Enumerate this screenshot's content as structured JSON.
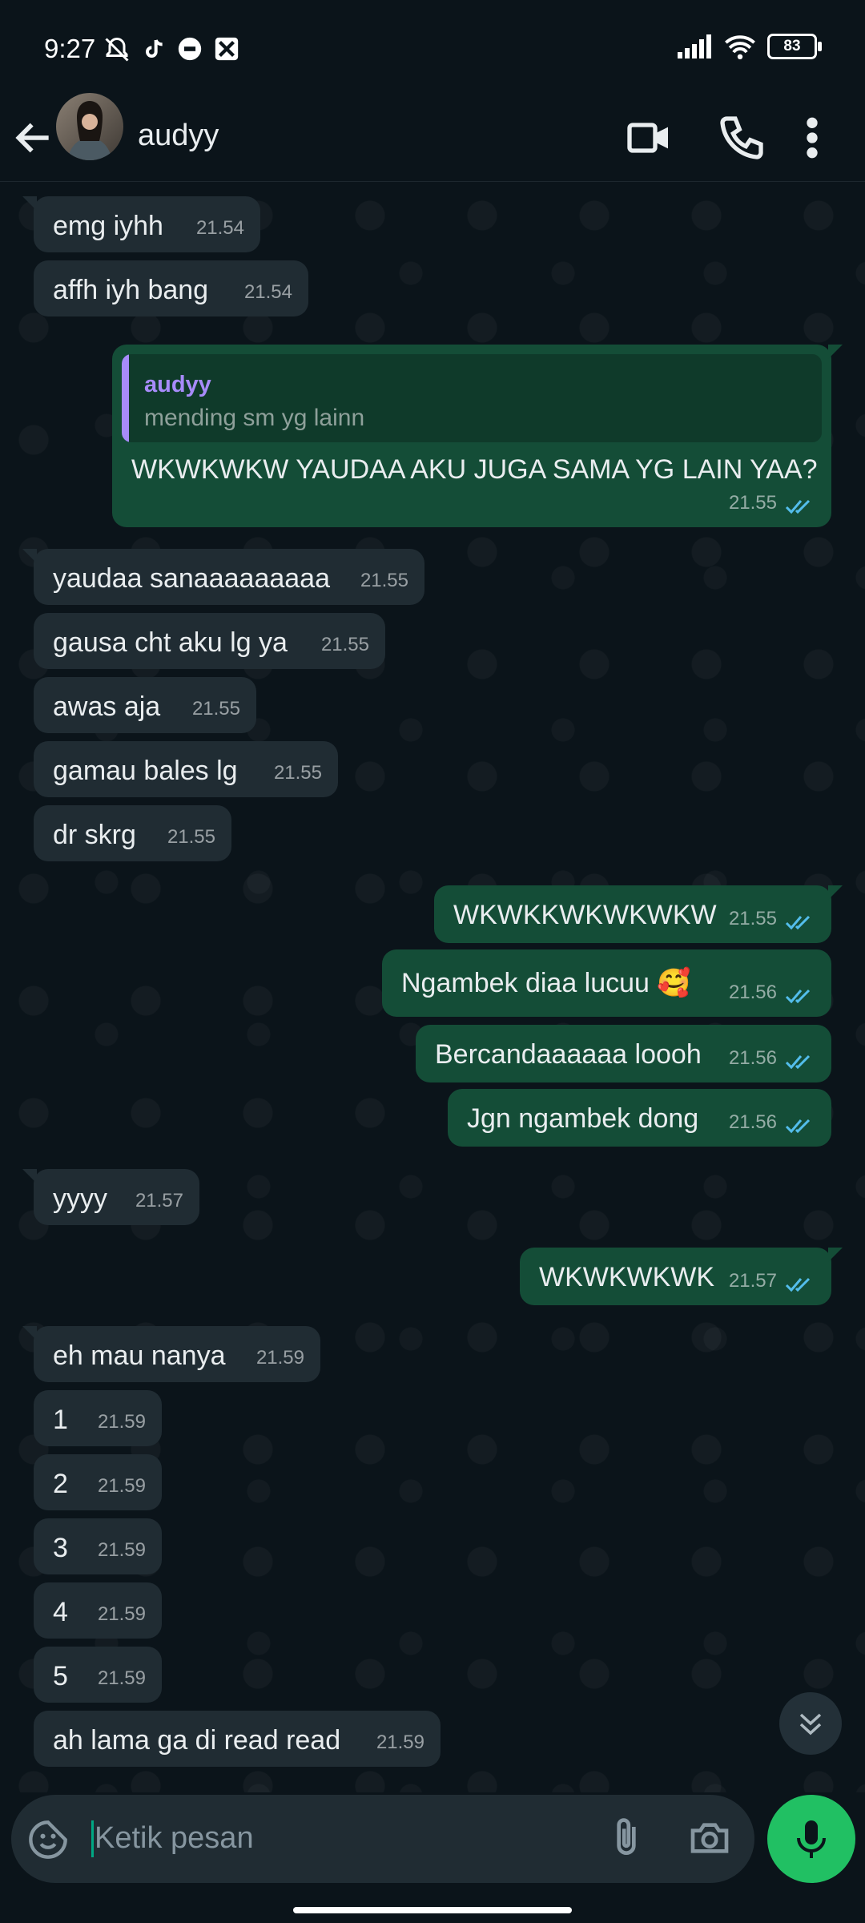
{
  "status_bar": {
    "time": "9:27",
    "battery": "83"
  },
  "header": {
    "contact_name": "audyy"
  },
  "messages": [
    {
      "text": "emg iyhh",
      "time": "21.54",
      "dir": "in"
    },
    {
      "text": "affh iyh bang",
      "time": "21.54",
      "dir": "in"
    },
    {
      "quote_name": "audyy",
      "quote_text": "mending sm yg lainn",
      "text": "WKWKWKW YAUDAA AKU JUGA SAMA YG LAIN YAA?",
      "time": "21.55",
      "dir": "out"
    },
    {
      "text": "yaudaa sanaaaaaaaaa",
      "time": "21.55",
      "dir": "in"
    },
    {
      "text": "gausa cht aku lg ya",
      "time": "21.55",
      "dir": "in"
    },
    {
      "text": "awas aja",
      "time": "21.55",
      "dir": "in"
    },
    {
      "text": "gamau bales lg",
      "time": "21.55",
      "dir": "in"
    },
    {
      "text": "dr skrg",
      "time": "21.55",
      "dir": "in"
    },
    {
      "text": "WKWKKWKWKWKW",
      "time": "21.55",
      "dir": "out"
    },
    {
      "text": "Ngambek diaa lucuu 🥰",
      "time": "21.56",
      "dir": "out"
    },
    {
      "text": "Bercandaaaaaa loooh",
      "time": "21.56",
      "dir": "out"
    },
    {
      "text": "Jgn ngambek dong",
      "time": "21.56",
      "dir": "out"
    },
    {
      "text": "yyyy",
      "time": "21.57",
      "dir": "in"
    },
    {
      "text": "WKWKWKWK",
      "time": "21.57",
      "dir": "out"
    },
    {
      "text": "eh mau nanya",
      "time": "21.59",
      "dir": "in"
    },
    {
      "text": "1",
      "time": "21.59",
      "dir": "in"
    },
    {
      "text": "2",
      "time": "21.59",
      "dir": "in"
    },
    {
      "text": "3",
      "time": "21.59",
      "dir": "in"
    },
    {
      "text": "4",
      "time": "21.59",
      "dir": "in"
    },
    {
      "text": "5",
      "time": "21.59",
      "dir": "in"
    },
    {
      "text": "ah lama ga di read read",
      "time": "21.59",
      "dir": "in"
    }
  ],
  "input": {
    "placeholder": "Ketik pesan"
  },
  "colors": {
    "accent": "#00a884",
    "mic": "#21c063",
    "outgoing": "#144d37",
    "incoming": "#202c33",
    "read_ticks": "#53bdeb"
  }
}
